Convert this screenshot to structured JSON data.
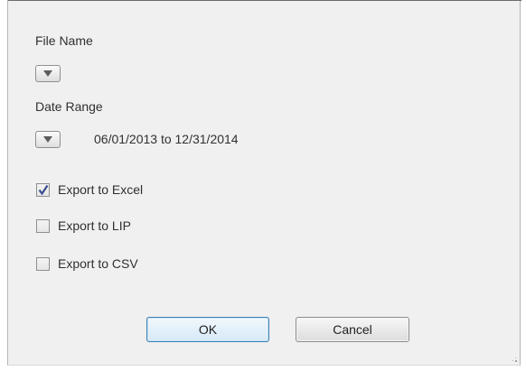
{
  "file_name": {
    "label": "File Name"
  },
  "date_range": {
    "label": "Date Range",
    "value": "06/01/2013 to 12/31/2014"
  },
  "export_options": [
    {
      "label": "Export to Excel",
      "checked": true
    },
    {
      "label": "Export to LIP",
      "checked": false
    },
    {
      "label": "Export to CSV",
      "checked": false
    }
  ],
  "buttons": {
    "ok": "OK",
    "cancel": "Cancel"
  },
  "colors": {
    "dialog_bg": "#f0f0f0",
    "ok_border": "#3c7fb1",
    "check_mark": "#3a4d8f"
  },
  "icons": {
    "dropdown": "triangle-down-icon",
    "check": "check-icon",
    "resize": "resize-grip-icon"
  }
}
